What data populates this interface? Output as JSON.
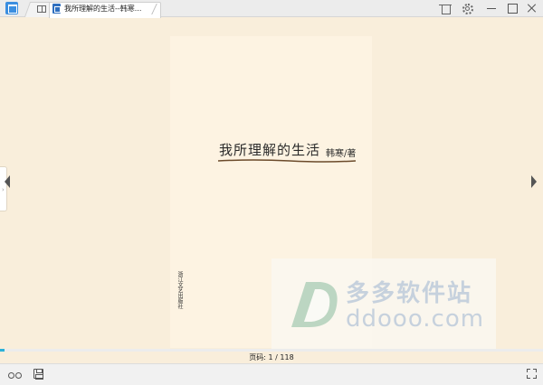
{
  "titlebar": {
    "app_icon": "reader-app-icon",
    "tabs": [
      {
        "icon": "bookshelf-icon",
        "label": ""
      },
      {
        "icon": "book-icon",
        "label": "我所理解的生活--韩寒..."
      }
    ],
    "controls": [
      "shirt-icon",
      "gear-icon",
      "minimize-icon",
      "maximize-icon",
      "close-icon"
    ]
  },
  "page": {
    "title": "我所理解的生活",
    "author": "韩寒/著",
    "publisher": "浙江文艺出版社"
  },
  "watermark": {
    "cn": "多多软件站",
    "en": "ddooo.com"
  },
  "progress": {
    "current_page": 1,
    "total_pages": 118,
    "fraction": 0.0085
  },
  "page_indicator": "页码: 1 / 118",
  "bottom_bar": {
    "icons": [
      "glasses-icon",
      "save-icon",
      "fullscreen-icon"
    ]
  },
  "colors": {
    "background": "#f9eedb",
    "page": "#fdf3e2",
    "progress": "#2bb1d8"
  }
}
